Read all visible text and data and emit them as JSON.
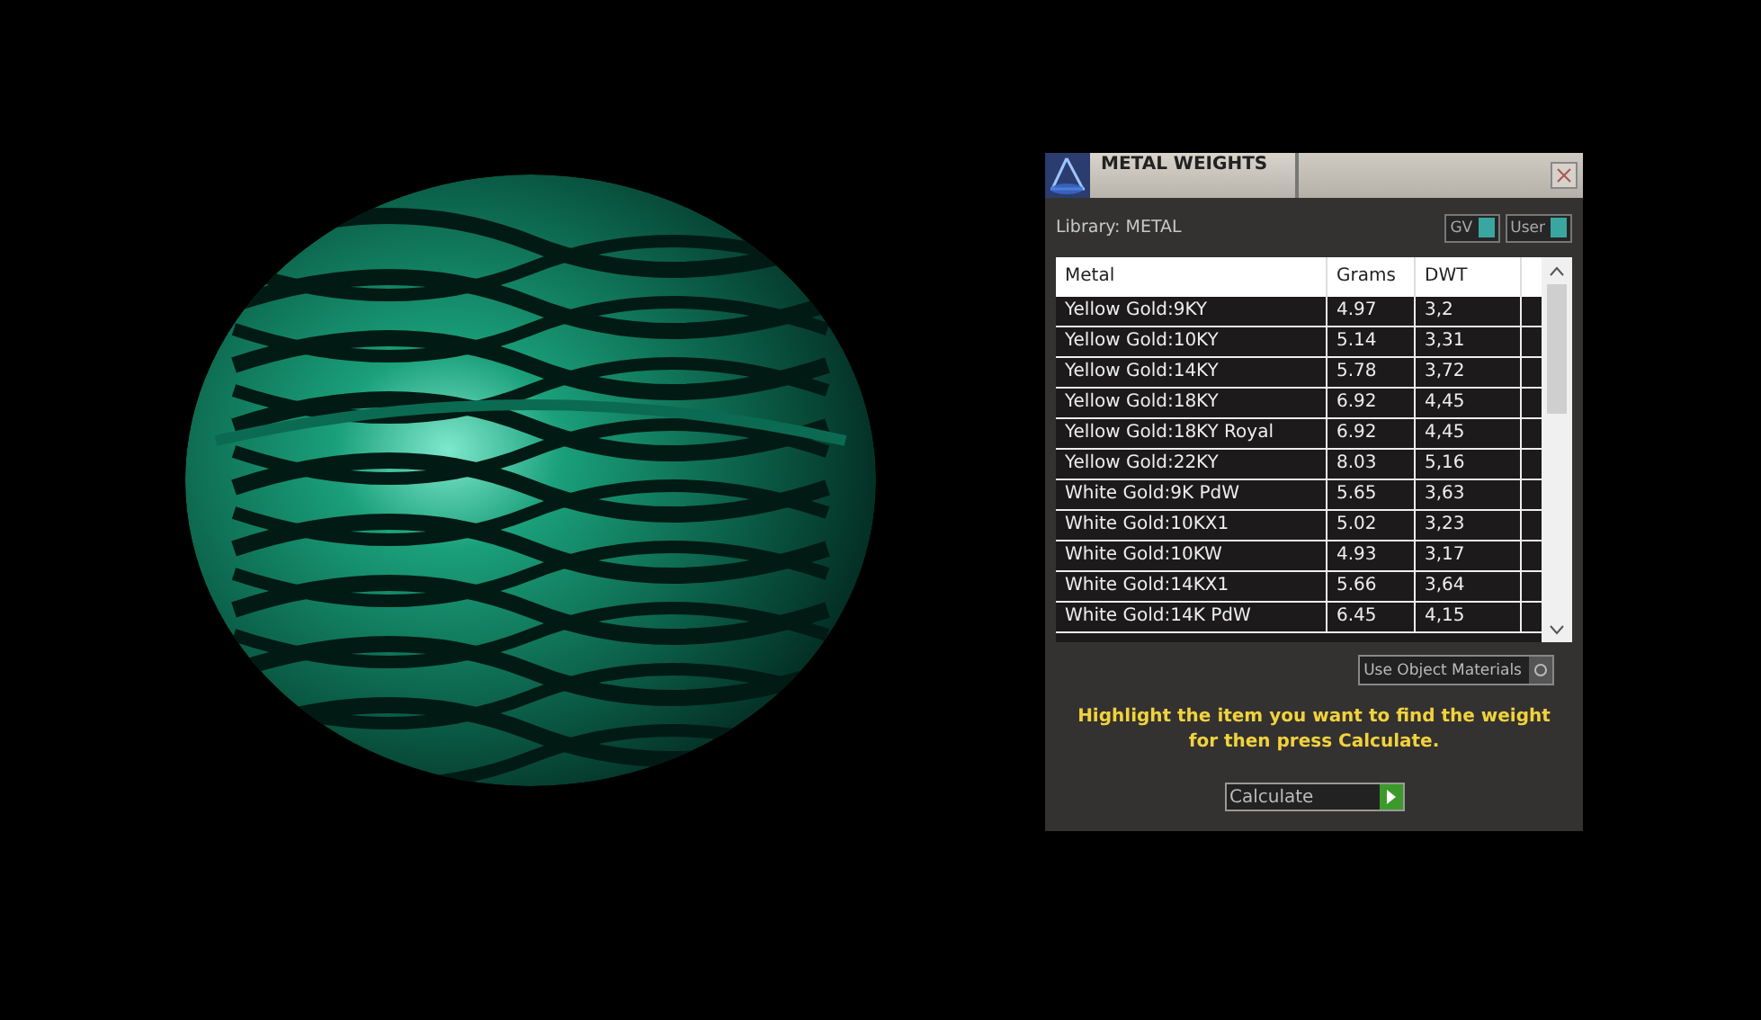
{
  "window": {
    "title": "METAL WEIGHTS"
  },
  "library": "Library: METAL",
  "toggles": [
    "GV",
    "User"
  ],
  "table": {
    "columns": [
      "Metal",
      "Grams",
      "DWT"
    ],
    "rows": [
      [
        "Yellow Gold:9KY",
        "4.97",
        "3,2"
      ],
      [
        "Yellow Gold:10KY",
        "5.14",
        "3,31"
      ],
      [
        "Yellow Gold:14KY",
        "5.78",
        "3,72"
      ],
      [
        "Yellow Gold:18KY",
        "6.92",
        "4,45"
      ],
      [
        "Yellow Gold:18KY Royal",
        "6.92",
        "4,45"
      ],
      [
        "Yellow Gold:22KY",
        "8.03",
        "5,16"
      ],
      [
        "White Gold:9K PdW",
        "5.65",
        "3,63"
      ],
      [
        "White Gold:10KX1",
        "5.02",
        "3,23"
      ],
      [
        "White Gold:10KW",
        "4.93",
        "3,17"
      ],
      [
        "White Gold:14KX1",
        "5.66",
        "3,64"
      ],
      [
        "White Gold:14K PdW",
        "6.45",
        "4,15"
      ]
    ]
  },
  "use_object_materials": "Use Object Materials",
  "hint": "Highlight the item you want to find the weight for then press Calculate.",
  "calculate": "Calculate"
}
